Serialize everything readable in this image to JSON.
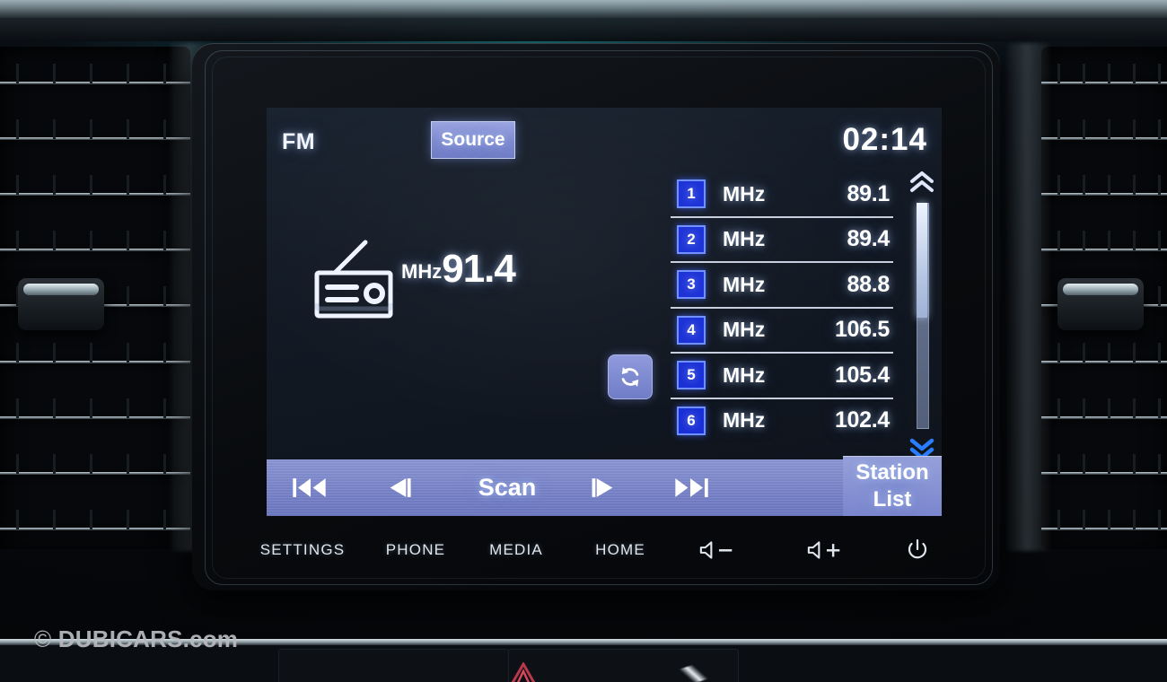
{
  "screen": {
    "band_label": "FM",
    "source_button": "Source",
    "clock": "02:14",
    "frequency": {
      "unit": "MHz",
      "value": "91.4"
    },
    "radio_icon": "radio-icon",
    "refresh_icon": "refresh-icon",
    "presets": [
      {
        "num": "1",
        "unit": "MHz",
        "value": "89.1"
      },
      {
        "num": "2",
        "unit": "MHz",
        "value": "89.4"
      },
      {
        "num": "3",
        "unit": "MHz",
        "value": "88.8"
      },
      {
        "num": "4",
        "unit": "MHz",
        "value": "106.5"
      },
      {
        "num": "5",
        "unit": "MHz",
        "value": "105.4"
      },
      {
        "num": "6",
        "unit": "MHz",
        "value": "102.4"
      }
    ],
    "scrollbar": {
      "up_icon": "double-chevron-up-icon",
      "down_icon": "double-chevron-down-icon"
    },
    "control_bar": {
      "skip_back_icon": "skip-previous-icon",
      "tune_down_icon": "tune-down-icon",
      "scan_label": "Scan",
      "tune_up_icon": "tune-up-icon",
      "skip_forward_icon": "skip-next-icon",
      "station_list_line1": "Station",
      "station_list_line2": "List"
    }
  },
  "hardware_buttons": [
    {
      "label": "SETTINGS"
    },
    {
      "label": "PHONE"
    },
    {
      "label": "MEDIA"
    },
    {
      "label": "HOME"
    },
    {
      "label": "",
      "icon": "volume-down-icon"
    },
    {
      "label": "",
      "icon": "volume-up-icon"
    },
    {
      "label": "",
      "icon": "power-icon"
    }
  ],
  "watermark": {
    "symbol": "©",
    "text": "DUBICARS.com"
  },
  "colors": {
    "accent_button": "#7d88cd",
    "preset_badge": "#1a2fd6",
    "preset_badge_border": "#6f90ff",
    "text": "#ffffff",
    "lcd_bg": "#131a25",
    "chevron_down": "#2a7dff"
  }
}
